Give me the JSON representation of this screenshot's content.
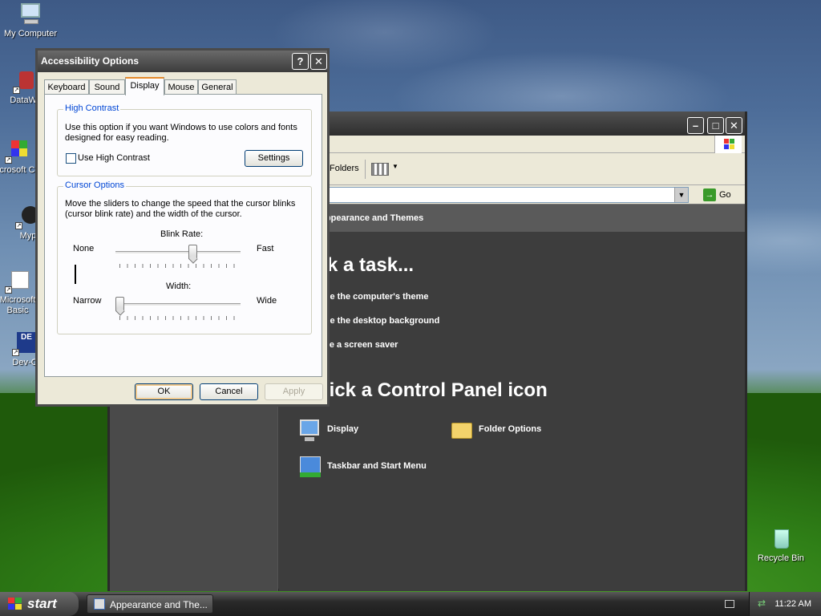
{
  "desktop": {
    "icons": [
      {
        "label": "My Computer"
      },
      {
        "label": "DataWa"
      },
      {
        "label": "Microsoft C++"
      },
      {
        "label": "Myp"
      },
      {
        "label": "Microsoft Basic"
      },
      {
        "label": "Dev-C"
      },
      {
        "label": "Recycle Bin"
      }
    ]
  },
  "control_panel": {
    "toolbar_folders": "Folders",
    "go_label": "Go",
    "header": "Appearance and Themes",
    "pick_task": "k a task...",
    "tasks": [
      "nge the computer's theme",
      "nge the desktop background",
      "ose a screen saver"
    ],
    "pick_icon": "pick a Control Panel icon",
    "icons": [
      "Display",
      "Folder Options",
      "Taskbar and Start Menu"
    ]
  },
  "dialog": {
    "title": "Accessibility Options",
    "help_btn": "?",
    "close_btn": "✕",
    "tabs": [
      "Keyboard",
      "Sound",
      "Display",
      "Mouse",
      "General"
    ],
    "active_tab": "Display",
    "high_contrast": {
      "label": "High Contrast",
      "description": "Use this option if you want Windows to use colors and fonts designed for easy reading.",
      "checkbox_label": "Use High Contrast",
      "checked": false,
      "settings_button": "Settings"
    },
    "cursor_options": {
      "label": "Cursor Options",
      "description": "Move the sliders to change the speed that the cursor blinks (cursor blink rate) and the width of the cursor.",
      "blink_rate_label": "Blink Rate:",
      "blink_min": "None",
      "blink_max": "Fast",
      "blink_value": 0.63,
      "width_label": "Width:",
      "width_min": "Narrow",
      "width_max": "Wide",
      "width_value": 0.0
    },
    "buttons": {
      "ok": "OK",
      "cancel": "Cancel",
      "apply": "Apply"
    }
  },
  "taskbar": {
    "start_label": "start",
    "task_button": "Appearance and The...",
    "clock": "11:22 AM"
  }
}
